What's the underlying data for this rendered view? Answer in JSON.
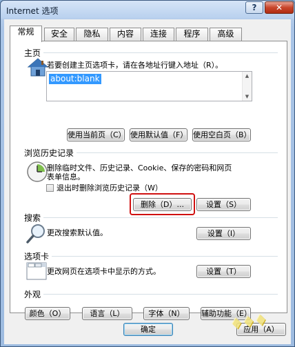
{
  "window": {
    "title": "Internet 选项",
    "help_glyph": "?",
    "close_glyph": "✕"
  },
  "tabs": [
    "常规",
    "安全",
    "隐私",
    "内容",
    "连接",
    "程序",
    "高级"
  ],
  "home": {
    "group_label": "主页",
    "description": "若要创建主页选项卡，请在各地址行键入地址（R）。",
    "url_value": "about:blank",
    "buttons": [
      "使用当前页（C）",
      "使用默认值（F）",
      "使用空白页（B）"
    ]
  },
  "history": {
    "group_label": "浏览历史记录",
    "description_line1": "删除临时文件、历史记录、Cookie、保存的密码和网页",
    "description_line2": "表单信息。",
    "checkbox_label": "退出时删除浏览历史记录（W）",
    "delete_button": "删除（D）...",
    "settings_button": "设置（S）"
  },
  "search": {
    "group_label": "搜索",
    "description": "更改搜索默认值。",
    "settings_button": "设置（I）"
  },
  "tabbed": {
    "group_label": "选项卡",
    "description": "更改网页在选项卡中显示的方式。",
    "settings_button": "设置（T）"
  },
  "appearance": {
    "group_label": "外观",
    "buttons": [
      "颜色（O）",
      "语言（L）",
      "字体（N）",
      "辅助功能（E）"
    ]
  },
  "footer": {
    "ok_button": "确定",
    "apply_button": "应用（A）"
  },
  "colors": {
    "highlight": "#d01010",
    "selection": "#3399ff"
  }
}
